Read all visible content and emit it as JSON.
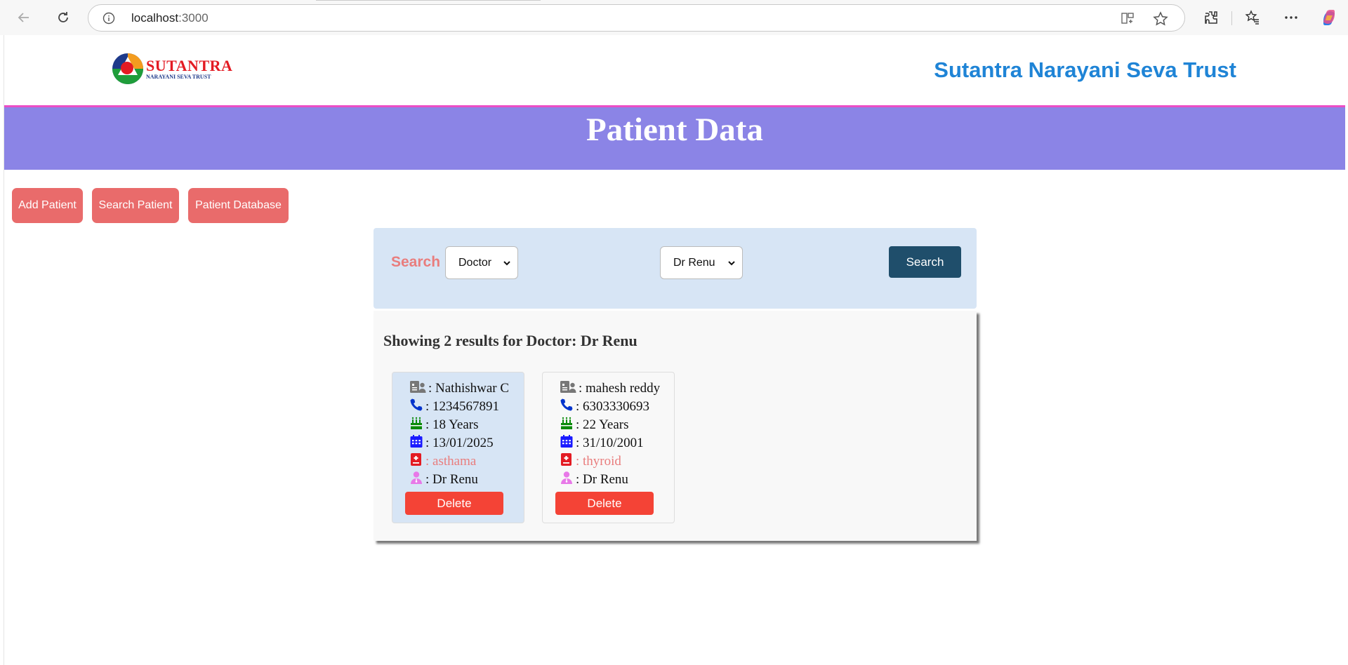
{
  "browser": {
    "url_host": "localhost",
    "url_port": ":3000"
  },
  "header": {
    "logo_title": "SUTANTRA",
    "logo_subtitle": "NARAYANI SEVA TRUST",
    "trust_name": "Sutantra Narayani Seva Trust"
  },
  "banner": {
    "title": "Patient Data"
  },
  "nav": {
    "add_patient": "Add Patient",
    "search_patient": "Search Patient",
    "patient_database": "Patient Database"
  },
  "search": {
    "label": "Search :",
    "field_value": "Doctor",
    "doctor_value": "Dr Renu",
    "button": "Search"
  },
  "results": {
    "title": "Showing 2 results for Doctor: Dr Renu",
    "patients": [
      {
        "name": ": Nathishwar C",
        "phone": ": 1234567891",
        "age": ": 18 Years",
        "date": ": 13/01/2025",
        "disease": ": asthama",
        "doctor": ": Dr Renu",
        "delete": "Delete"
      },
      {
        "name": ": mahesh reddy",
        "phone": ": 6303330693",
        "age": ": 22 Years",
        "date": ": 31/10/2001",
        "disease": ": thyroid",
        "doctor": ": Dr Renu",
        "delete": "Delete"
      }
    ]
  },
  "colors": {
    "banner": "#8b84e6",
    "accent_line": "#ea4ec5",
    "nav_button": "#e96b6b",
    "search_button": "#1f4e6b",
    "delete_button": "#f44336",
    "trust_name": "#1f84d6"
  },
  "icons": [
    "back-icon",
    "reload-icon",
    "info-icon",
    "split-screen-icon",
    "favorite-star-icon",
    "extensions-icon",
    "favorites-icon",
    "more-icon",
    "copilot-icon",
    "id-card-icon",
    "phone-icon",
    "cake-icon",
    "calendar-icon",
    "medical-icon",
    "doctor-icon"
  ]
}
